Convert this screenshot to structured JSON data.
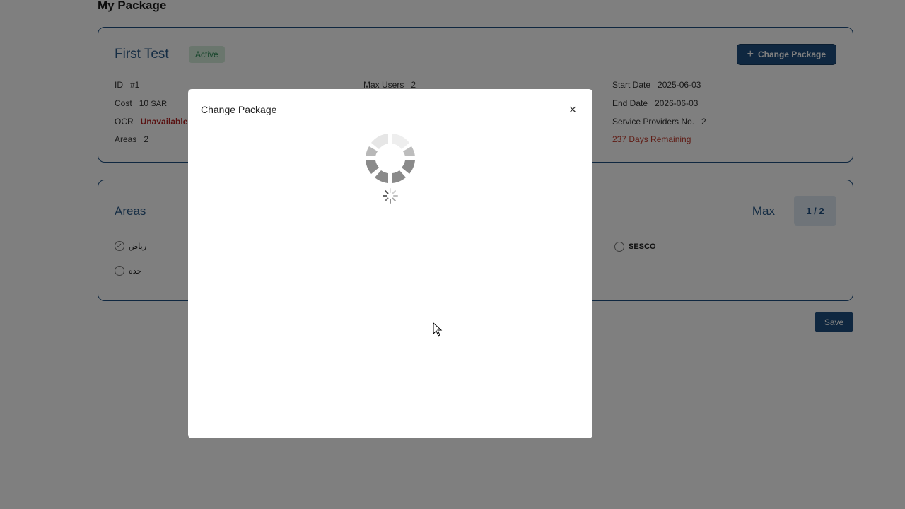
{
  "page": {
    "title": "My Package"
  },
  "package": {
    "name": "First Test",
    "status": "Active",
    "change_button": "Change Package",
    "id_label": "ID",
    "id_value": "#1",
    "cost_label": "Cost",
    "cost_value": "10",
    "cost_currency": "SAR",
    "ocr_label": "OCR",
    "ocr_value": "Unavailable",
    "areas_label": "Areas",
    "areas_value": "2",
    "max_users_label": "Max Users",
    "max_users_value": "2",
    "start_date_label": "Start Date",
    "start_date_value": "2025-06-03",
    "end_date_label": "End Date",
    "end_date_value": "2026-06-03",
    "service_providers_label": "Service Providers No.",
    "service_providers_value": "2",
    "remaining": "237 Days Remaining"
  },
  "areas": {
    "title": "Areas",
    "max_label": "Max",
    "max_value": "1 / 2",
    "items": [
      {
        "label": "رياض",
        "checked": true
      },
      {
        "label": "جده",
        "checked": false
      },
      {
        "label": "SESCO",
        "checked": false
      }
    ]
  },
  "save_button": "Save",
  "modal": {
    "title": "Change Package",
    "close_symbol": "×"
  },
  "colors": {
    "primary": "#1e4f80",
    "badge_bg": "#d4edda",
    "badge_text": "#2e8b57",
    "danger": "#b22222"
  },
  "icons": [
    "plus-icon",
    "close-icon",
    "check-icon",
    "loading-spinner-icon",
    "cursor-icon"
  ]
}
